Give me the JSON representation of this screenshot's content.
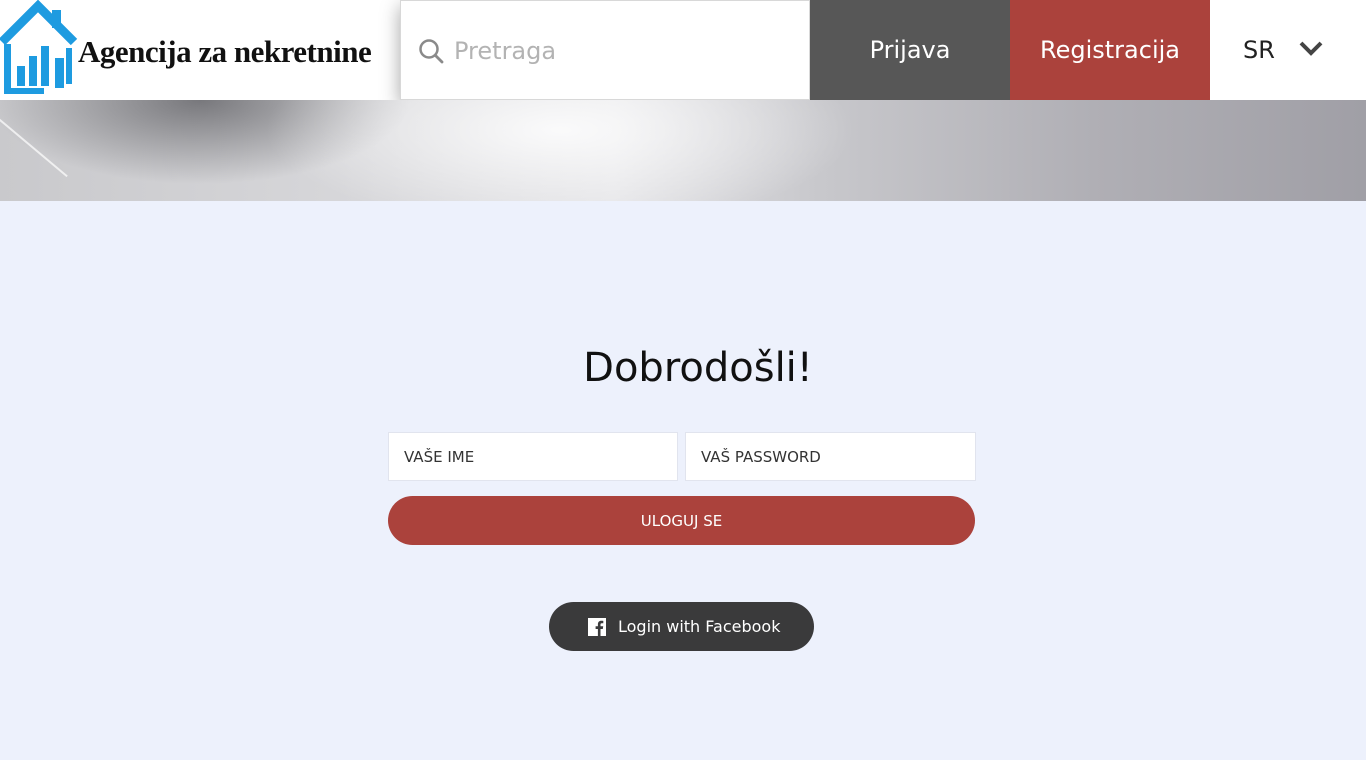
{
  "header": {
    "logo_text": "Agencija za nekretnine",
    "search_placeholder": "Pretraga",
    "search_icon": "search-icon",
    "login_label": "Prijava",
    "register_label": "Registracija",
    "language": "SR",
    "language_icon": "chevron-down-icon"
  },
  "main": {
    "title": "Dobrodošli!",
    "name_placeholder": "VAŠE IME",
    "password_placeholder": "VAŠ PASSWORD",
    "submit_label": "ULOGUJ SE",
    "facebook_label": "Login with Facebook",
    "facebook_icon": "facebook-icon"
  },
  "colors": {
    "accent": "#ab423c",
    "dark_button": "#575757",
    "facebook_button": "#3a3a3b",
    "background": "#edf1fc",
    "logo_blue": "#1e9be0"
  }
}
